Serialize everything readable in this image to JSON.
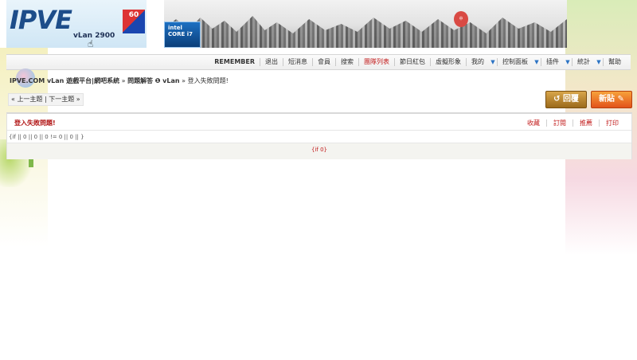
{
  "header": {
    "logo_text": "IPVE",
    "logo_subtitle": "vLan 2900",
    "logo_badge": "60",
    "intel_brand": "intel",
    "intel_model": "CORE i7",
    "balloon_text": "中"
  },
  "nav": {
    "brand": "REMEMBER",
    "items": [
      {
        "label": "退出",
        "dropdown": false
      },
      {
        "label": "短消息",
        "dropdown": false
      },
      {
        "label": "會員",
        "dropdown": false
      },
      {
        "label": "搜索",
        "dropdown": false
      },
      {
        "label": "團隊列表",
        "dropdown": false,
        "highlight": true
      },
      {
        "label": "節日紅包",
        "dropdown": false
      },
      {
        "label": "虛擬形象",
        "dropdown": false
      },
      {
        "label": "我的",
        "dropdown": true
      },
      {
        "label": "控制面板",
        "dropdown": true
      },
      {
        "label": "插件",
        "dropdown": true
      },
      {
        "label": "統計",
        "dropdown": true
      },
      {
        "label": "幫助",
        "dropdown": false
      }
    ]
  },
  "breadcrumb": {
    "site": "IPVE.COM vLan 遊戲平台|網吧系統",
    "sep1": "»",
    "section": "問題解答",
    "subsection": "❶ vLan",
    "sep2": "»",
    "current": "登入失敗問題!"
  },
  "thread_nav": {
    "prev_label": "« 上一主題",
    "divider": "|",
    "next_label": "下一主題 »"
  },
  "buttons": {
    "reply": "回覆",
    "new_post": "新貼"
  },
  "thread": {
    "title": "登入失敗問題!",
    "actions": [
      "收藏",
      "訂閱",
      "推薦",
      "打印"
    ],
    "content": "{if || 0 || 0 || 0 != 0 || 0 || }",
    "footer": "{if 0}"
  },
  "colors": {
    "accent_red": "#c21b1b",
    "nav_arrow": "#2b73c4"
  }
}
